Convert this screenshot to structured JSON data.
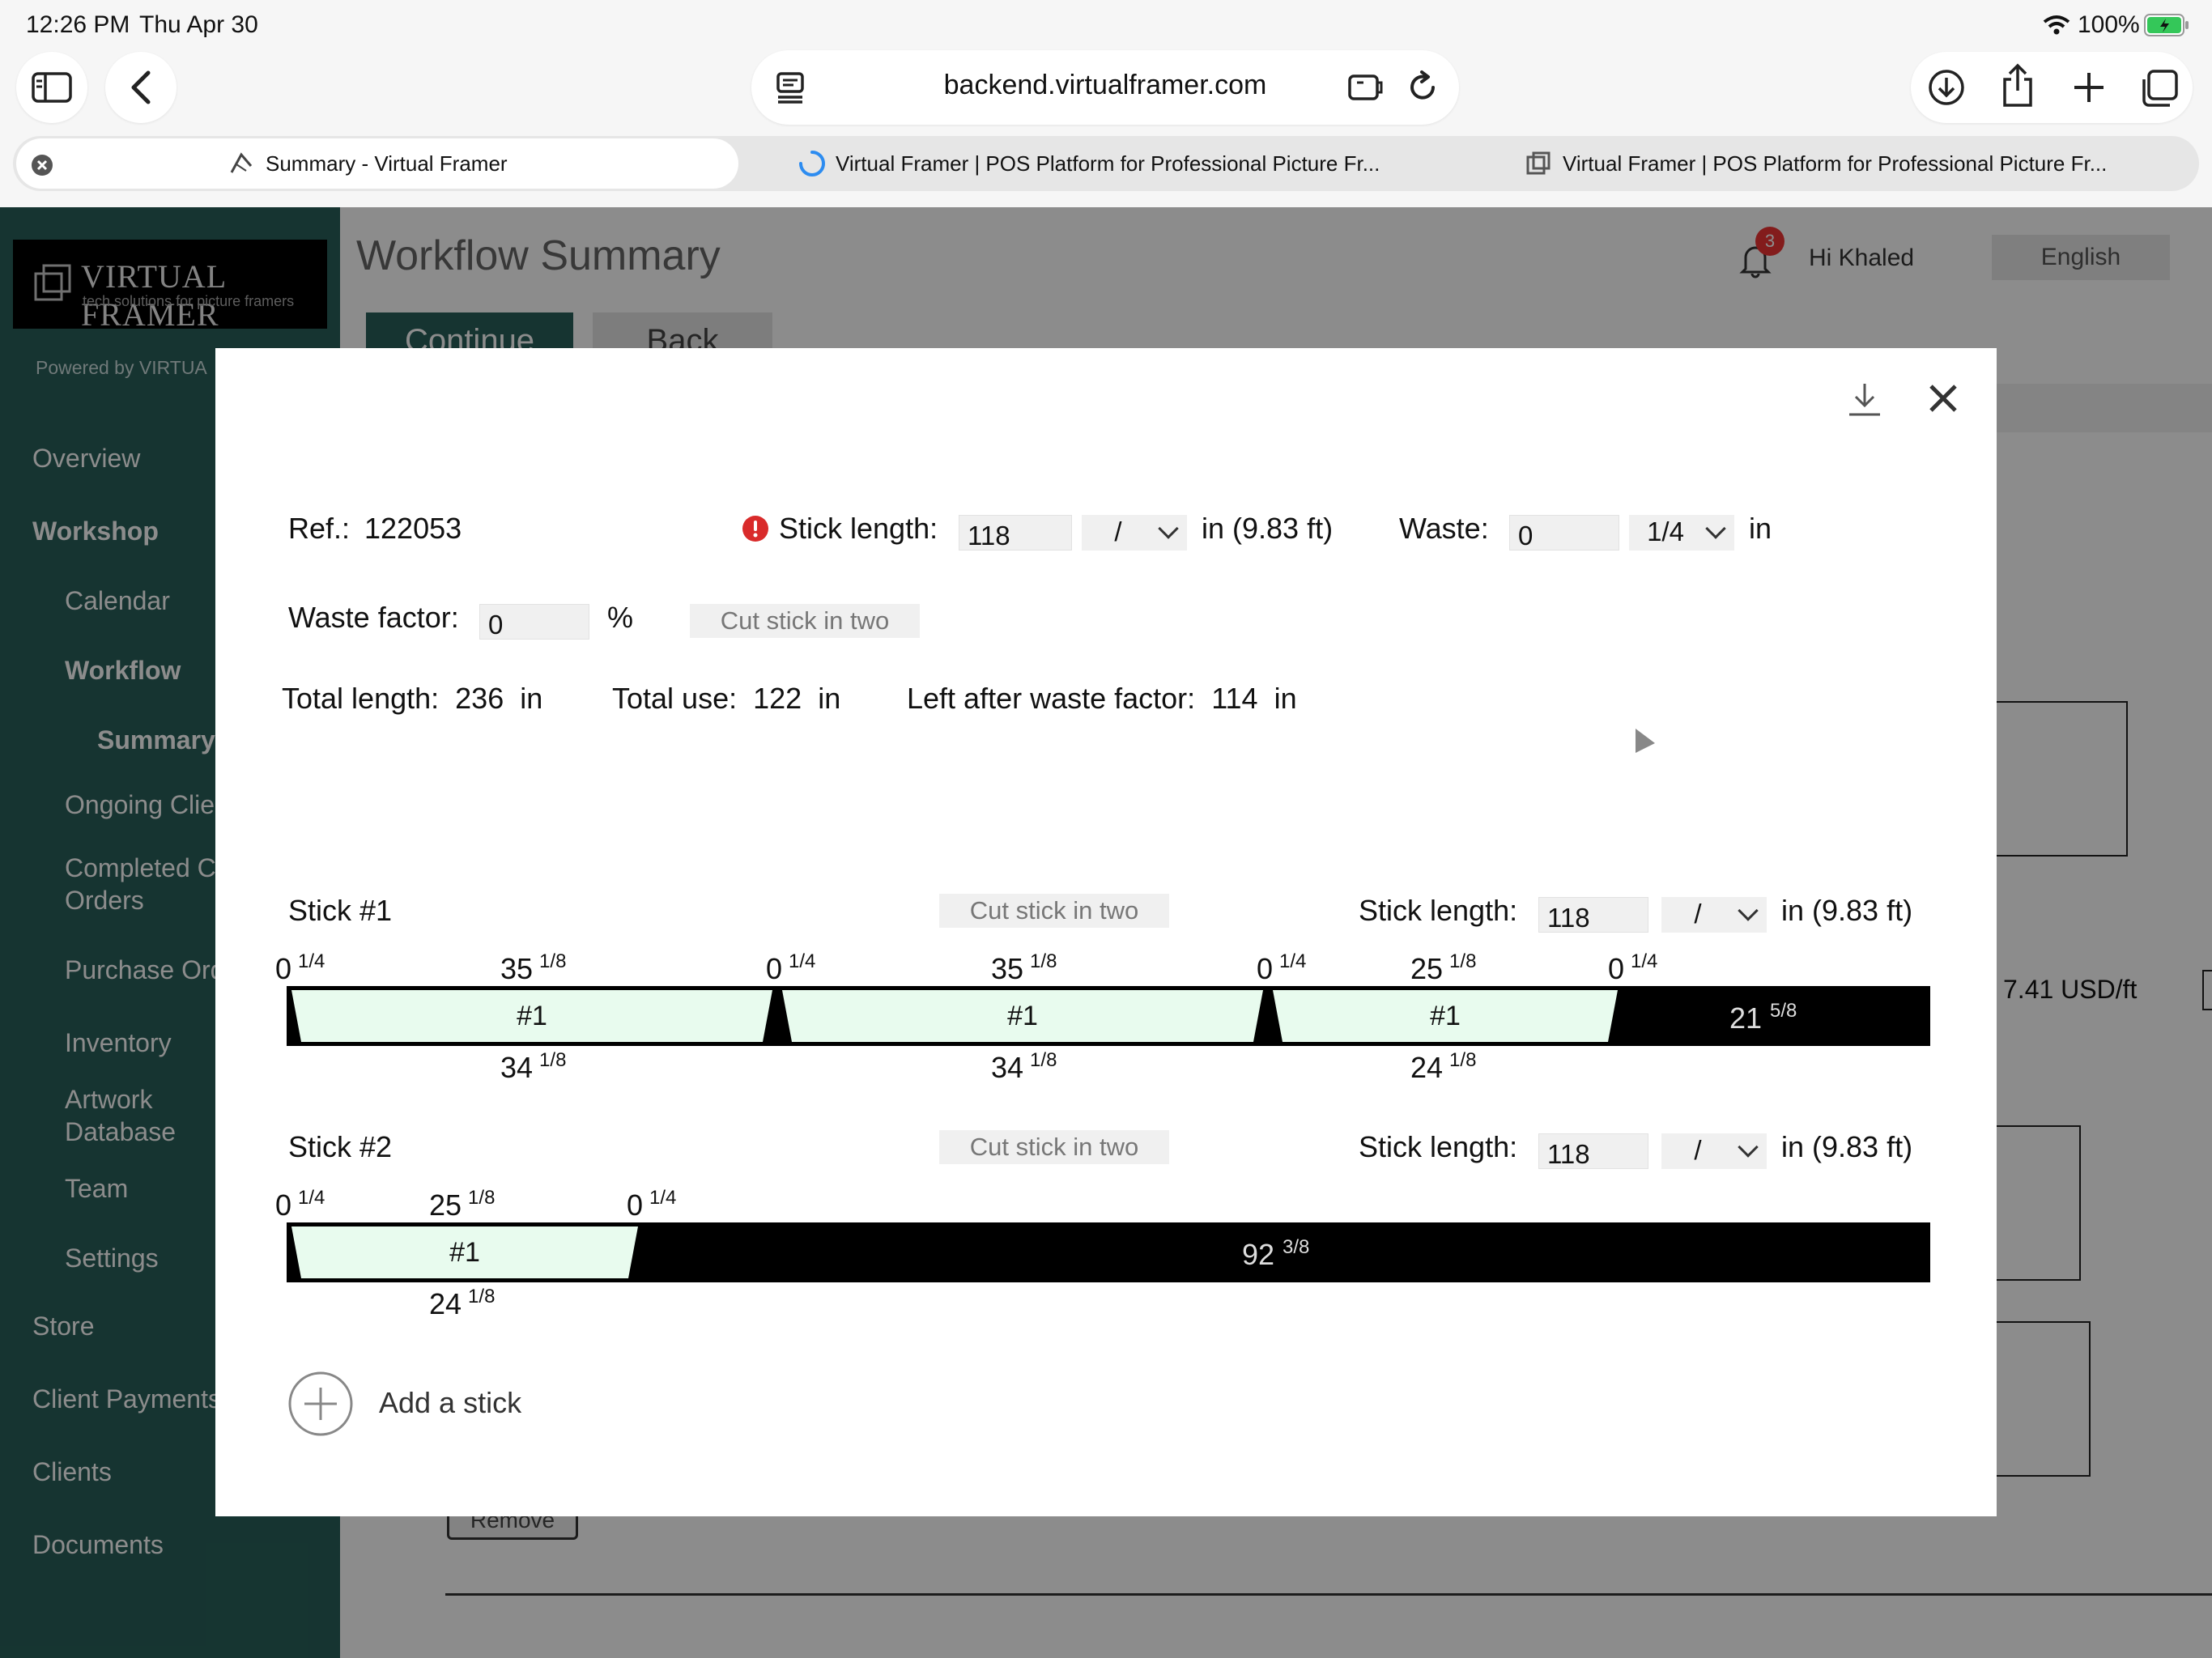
{
  "status_bar": {
    "time": "12:26 PM",
    "date": "Thu Apr 30",
    "battery": "100%"
  },
  "browser": {
    "url": "backend.virtualframer.com",
    "tabs": [
      {
        "label": "Summary - Virtual Framer"
      },
      {
        "label": "Virtual Framer | POS Platform for Professional Picture Fr..."
      },
      {
        "label": "Virtual Framer | POS Platform for Professional Picture Fr..."
      }
    ]
  },
  "app": {
    "logo_main": "VIRTUAL FRAMER",
    "logo_tagline": "tech solutions for picture framers",
    "powered_by": "Powered by VIRTUA",
    "page_title_1": "Workflow",
    "page_title_2": "Summary",
    "continue_label": "Continue",
    "back_label": "Back",
    "notification_count": "3",
    "greeting": "Hi Khaled",
    "language": "English",
    "price_fragment": "7.41 USD/ft",
    "remove_label": "Remove",
    "sidebar": {
      "overview": "Overview",
      "workshop": "Workshop",
      "calendar": "Calendar",
      "workflow": "Workflow",
      "summary": "Summary",
      "ongoing": "Ongoing Clie",
      "completed_1": "Completed C",
      "completed_2": "Orders",
      "purchase": "Purchase Ord",
      "inventory": "Inventory",
      "artwork_1": "Artwork",
      "artwork_2": "Database",
      "team": "Team",
      "settings": "Settings",
      "store": "Store",
      "client_payments": "Client Payments",
      "clients": "Clients",
      "documents": "Documents"
    }
  },
  "modal": {
    "ref_label": "Ref.:",
    "ref_value": "122053",
    "stick_length_label": "Stick length:",
    "stick_length_value": "118",
    "fraction_value": "/",
    "stick_unit": "in (9.83 ft)",
    "waste_label": "Waste:",
    "waste_value": "0",
    "waste_fraction": "1/4",
    "waste_unit": "in",
    "waste_factor_label": "Waste factor:",
    "waste_factor_value": "0",
    "percent": "%",
    "cut_label": "Cut stick in two",
    "total_length_label": "Total length:",
    "total_length_value": "236",
    "total_use_label": "Total use:",
    "total_use_value": "122",
    "left_label": "Left after waste factor:",
    "left_value": "114",
    "unit_in": "in",
    "add_stick_label": "Add a stick",
    "sticks": [
      {
        "title": "Stick #1",
        "length": "118",
        "waste_labels": [
          {
            "whole": "0",
            "frac": "1/4"
          },
          {
            "whole": "0",
            "frac": "1/4"
          },
          {
            "whole": "0",
            "frac": "1/4"
          },
          {
            "whole": "0",
            "frac": "1/4"
          }
        ],
        "pieces": [
          {
            "label": "#1",
            "outer_whole": "35",
            "outer_frac": "1/8",
            "inner_whole": "34",
            "inner_frac": "1/8"
          },
          {
            "label": "#1",
            "outer_whole": "35",
            "outer_frac": "1/8",
            "inner_whole": "34",
            "inner_frac": "1/8"
          },
          {
            "label": "#1",
            "outer_whole": "25",
            "outer_frac": "1/8",
            "inner_whole": "24",
            "inner_frac": "1/8"
          }
        ],
        "remainder_whole": "21",
        "remainder_frac": "5/8"
      },
      {
        "title": "Stick #2",
        "length": "118",
        "waste_labels": [
          {
            "whole": "0",
            "frac": "1/4"
          },
          {
            "whole": "0",
            "frac": "1/4"
          }
        ],
        "pieces": [
          {
            "label": "#1",
            "outer_whole": "25",
            "outer_frac": "1/8",
            "inner_whole": "24",
            "inner_frac": "1/8"
          }
        ],
        "remainder_whole": "92",
        "remainder_frac": "3/8"
      }
    ]
  }
}
